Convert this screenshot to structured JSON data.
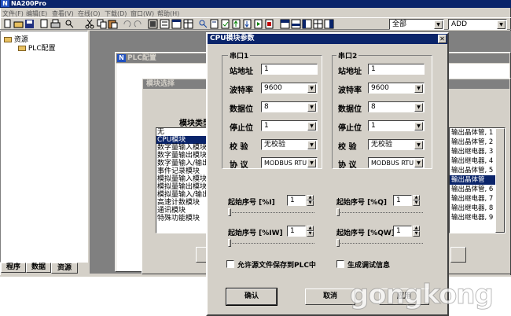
{
  "app": {
    "title": "NA200Pro",
    "icon_letter": "N"
  },
  "menu": [
    "文件(F)",
    "编辑(E)",
    "查看(V)",
    "在线(O)",
    "下载(D)",
    "窗口(W)",
    "帮助(H)"
  ],
  "toolbar": {
    "combo1_value": "全部",
    "combo2_value": "ADD"
  },
  "project_tree": {
    "root": "资源",
    "child": "PLC配置"
  },
  "bottom_tabs": [
    "程序",
    "数据",
    "资源"
  ],
  "plc_window": {
    "title": "PLC配置"
  },
  "module_dialog": {
    "title": "模块选择",
    "type_label": "模块类型",
    "types": [
      "无",
      "CPU模块",
      "数字量输入模块",
      "数字量输出模块",
      "数字量输入/输出",
      "事件记录模块",
      "模拟量输入模块",
      "模拟量输出模块",
      "模拟量输入/输出",
      "高速计数模块",
      "通讯模块",
      "特殊功能模块"
    ],
    "desc_items": [
      "输出晶体管, 1",
      "输出晶体管, 2",
      "输出继电器, 3",
      "输出继电器, 4",
      "输出晶体管, 5",
      "輸出晶体管",
      "",
      "输出晶体管, 6",
      "输出继电器, 7",
      "输出继电器, 8",
      "输出继电器, 9"
    ]
  },
  "cpu_dialog": {
    "title": "CPU模块参数",
    "close_glyph": "✕",
    "port1": {
      "title": "串口1",
      "station_label": "站地址",
      "station_value": "1",
      "baud_label": "波特率",
      "baud_value": "9600",
      "databits_label": "数据位",
      "databits_value": "8",
      "stopbits_label": "停止位",
      "stopbits_value": "1",
      "parity_label": "校  验",
      "parity_value": "无校验",
      "protocol_label": "协  议",
      "protocol_value": "MODBUS RTU"
    },
    "port2": {
      "title": "串口2",
      "station_label": "站地址",
      "station_value": "1",
      "baud_label": "波特率",
      "baud_value": "9600",
      "databits_label": "数据位",
      "databits_value": "8",
      "stopbits_label": "停止位",
      "stopbits_value": "1",
      "parity_label": "校  验",
      "parity_value": "无校验",
      "protocol_label": "协  议",
      "protocol_value": "MODBUS RTU"
    },
    "start_i_label": "起始序号 [%I]",
    "start_i_value": "1",
    "start_q_label": "起始序号 [%Q]",
    "start_q_value": "1",
    "start_iw_label": "起始序号 [%IW]",
    "start_iw_value": "1",
    "start_qw_label": "起始序号 [%QW]",
    "start_qw_value": "1",
    "allow_save_label": "允许源文件保存到PLC中",
    "gen_debug_label": "生成调试信息",
    "ok_label": "确认",
    "cancel_label": "取消",
    "apply_label": "应用"
  },
  "watermark": "gongkong"
}
